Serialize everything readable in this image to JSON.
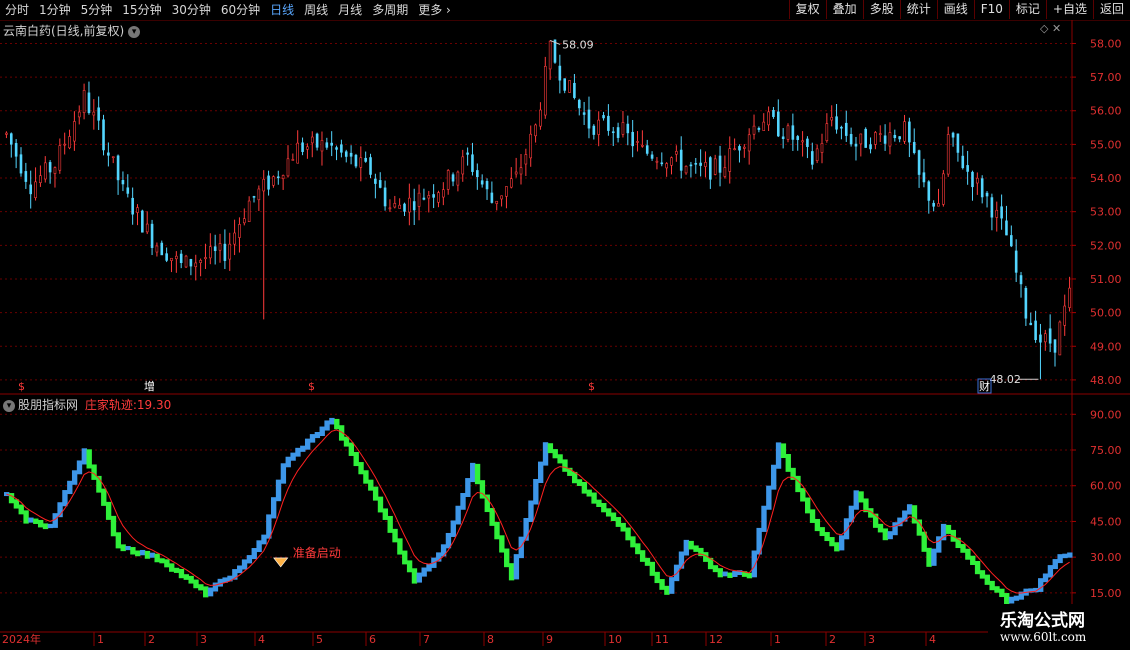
{
  "toolbar": {
    "periods": [
      "分时",
      "1分钟",
      "5分钟",
      "15分钟",
      "30分钟",
      "60分钟",
      "日线",
      "周线",
      "月线",
      "多周期",
      "更多"
    ],
    "active_period": "日线",
    "buttons": [
      "复权",
      "叠加",
      "多股",
      "统计",
      "画线",
      "F10",
      "标记",
      "+自选",
      "返回"
    ]
  },
  "main_chart": {
    "title": "云南白药(日线,前复权)",
    "high_label": "58.09",
    "low_label": "48.02",
    "y_ticks": [
      "58.00",
      "57.00",
      "56.00",
      "55.00",
      "54.00",
      "53.00",
      "52.00",
      "51.00",
      "50.00",
      "49.00",
      "48.00"
    ],
    "event_markers": [
      "$",
      "增",
      "$",
      "$",
      "财"
    ]
  },
  "indicator": {
    "name": "股朋指标网",
    "series_label": "庄家轨迹:",
    "series_value": "19.30",
    "annotation": "准备启动",
    "y_ticks": [
      "90.00",
      "75.00",
      "60.00",
      "45.00",
      "30.00",
      "15.00"
    ]
  },
  "x_axis": {
    "labels": [
      "2024年",
      "1",
      "2",
      "3",
      "4",
      "5",
      "6",
      "7",
      "8",
      "9",
      "10",
      "11",
      "12",
      "1",
      "2",
      "3",
      "4"
    ]
  },
  "watermark": {
    "name": "乐淘公式网",
    "url": "www.60lt.com"
  },
  "chart_data": [
    {
      "type": "candlestick",
      "title": "云南白药(日线,前复权)",
      "ylim": [
        47.7,
        58.4
      ],
      "y_ticks": [
        58,
        57,
        56,
        55,
        54,
        53,
        52,
        51,
        50,
        49,
        48
      ],
      "annotations": [
        {
          "label": "58.09",
          "value": 58.09
        },
        {
          "label": "48.02",
          "value": 48.02
        }
      ],
      "waypoints": [
        [
          0,
          55.3
        ],
        [
          5,
          53.8
        ],
        [
          10,
          54.4
        ],
        [
          16,
          56.4
        ],
        [
          19,
          55.5
        ],
        [
          24,
          53.6
        ],
        [
          30,
          52.2
        ],
        [
          36,
          51.4
        ],
        [
          40,
          51.6
        ],
        [
          45,
          51.8
        ],
        [
          50,
          53.3
        ],
        [
          55,
          54.0
        ],
        [
          60,
          54.9
        ],
        [
          66,
          55.0
        ],
        [
          71,
          54.5
        ],
        [
          75,
          54.2
        ],
        [
          79,
          53.1
        ],
        [
          85,
          53.4
        ],
        [
          90,
          53.8
        ],
        [
          95,
          54.6
        ],
        [
          100,
          53.3
        ],
        [
          105,
          54.0
        ],
        [
          109,
          55.5
        ],
        [
          112,
          57.8
        ],
        [
          116,
          56.6
        ],
        [
          120,
          55.6
        ],
        [
          126,
          55.5
        ],
        [
          131,
          54.8
        ],
        [
          137,
          54.6
        ],
        [
          142,
          54.2
        ],
        [
          147,
          54.3
        ],
        [
          153,
          55.4
        ],
        [
          156,
          55.8
        ],
        [
          162,
          55.2
        ],
        [
          166,
          54.5
        ],
        [
          170,
          55.8
        ],
        [
          175,
          55.0
        ],
        [
          181,
          55.3
        ],
        [
          185,
          55.4
        ],
        [
          188,
          54.0
        ],
        [
          192,
          53.0
        ],
        [
          194,
          55.2
        ],
        [
          198,
          54.2
        ],
        [
          202,
          53.4
        ],
        [
          206,
          52.3
        ],
        [
          210,
          50.0
        ],
        [
          213,
          49.2
        ],
        [
          216,
          49.1
        ],
        [
          219,
          50.5
        ]
      ]
    },
    {
      "type": "line",
      "title": "庄家轨迹",
      "ylim": [
        12,
        96
      ],
      "y_ticks": [
        90,
        75,
        60,
        45,
        30,
        15
      ],
      "annotations": [
        {
          "label": "准备启动",
          "value": 28
        }
      ],
      "waypoints": [
        [
          0,
          56
        ],
        [
          4,
          46
        ],
        [
          9,
          43
        ],
        [
          16,
          75
        ],
        [
          23,
          35
        ],
        [
          32,
          29
        ],
        [
          41,
          15
        ],
        [
          48,
          25
        ],
        [
          53,
          39
        ],
        [
          57,
          69
        ],
        [
          67,
          88
        ],
        [
          76,
          55
        ],
        [
          84,
          20
        ],
        [
          90,
          34
        ],
        [
          96,
          68
        ],
        [
          104,
          22
        ],
        [
          111,
          77
        ],
        [
          119,
          58
        ],
        [
          127,
          42
        ],
        [
          136,
          15
        ],
        [
          140,
          37
        ],
        [
          147,
          23
        ],
        [
          153,
          23
        ],
        [
          159,
          77
        ],
        [
          166,
          45
        ],
        [
          171,
          33
        ],
        [
          175,
          57
        ],
        [
          181,
          38
        ],
        [
          186,
          52
        ],
        [
          190,
          27
        ],
        [
          193,
          43
        ],
        [
          196,
          35
        ],
        [
          201,
          22
        ],
        [
          206,
          12
        ],
        [
          212,
          17
        ],
        [
          217,
          31
        ]
      ],
      "value": 19.3
    }
  ]
}
